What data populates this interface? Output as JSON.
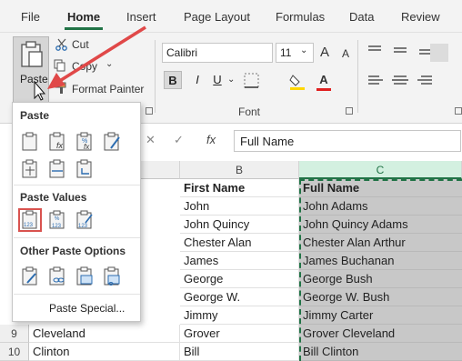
{
  "menubar": {
    "items": [
      "File",
      "Home",
      "Insert",
      "Page Layout",
      "Formulas",
      "Data",
      "Review"
    ],
    "active": "Home"
  },
  "clipboard": {
    "paste_label": "Paste",
    "cut_label": "Cut",
    "copy_label": "Copy",
    "format_painter_label": "Format Painter"
  },
  "font": {
    "name": "Calibri",
    "size": "11",
    "group_label": "Font",
    "bold": "B",
    "italic": "I",
    "underline": "U",
    "grow": "A",
    "shrink": "A",
    "font_color_letter": "A"
  },
  "formula_bar": {
    "fx": "fx",
    "value": "Full Name"
  },
  "columns": [
    "B",
    "C"
  ],
  "rows": [
    {
      "num": "",
      "a": "",
      "b": "First Name",
      "c": "Full Name",
      "header": true
    },
    {
      "num": "",
      "a": "",
      "b": "John",
      "c": "John  Adams"
    },
    {
      "num": "",
      "a": "",
      "b": "John Quincy",
      "c": "John Quincy  Adams"
    },
    {
      "num": "",
      "a": "",
      "b": "Chester Alan",
      "c": "Chester Alan  Arthur"
    },
    {
      "num": "",
      "a": "",
      "b": "James",
      "c": "James  Buchanan"
    },
    {
      "num": "",
      "a": "",
      "b": "George",
      "c": "George  Bush"
    },
    {
      "num": "",
      "a": "",
      "b": "George W.",
      "c": "George W.  Bush"
    },
    {
      "num": "",
      "a": "",
      "b": "Jimmy",
      "c": "Jimmy  Carter"
    },
    {
      "num": "9",
      "a": "Cleveland",
      "b": "Grover",
      "c": "Grover  Cleveland"
    },
    {
      "num": "10",
      "a": "Clinton",
      "b": "Bill",
      "c": "Bill  Clinton"
    }
  ],
  "dropdown": {
    "paste_heading": "Paste",
    "paste_values_heading": "Paste Values",
    "other_heading": "Other Paste Options",
    "paste_special": "Paste Special..."
  },
  "colors": {
    "accent_green": "#217346",
    "arrow_red": "#e04848",
    "highlight_red": "#d9534f"
  }
}
